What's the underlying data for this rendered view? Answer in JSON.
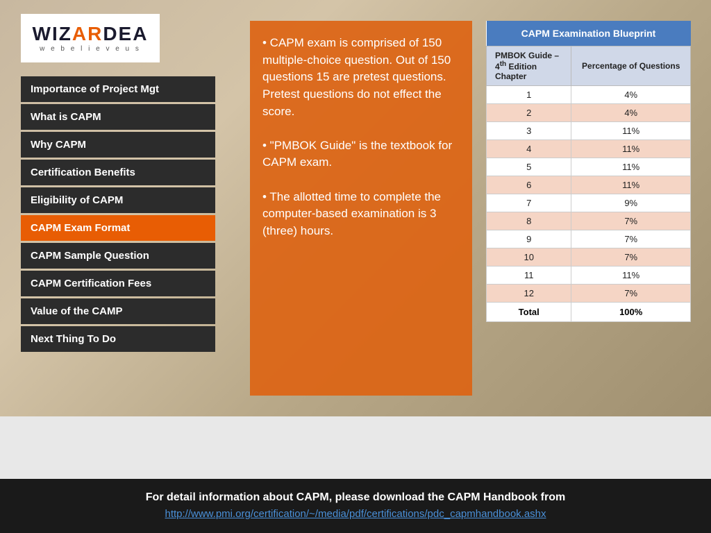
{
  "logo": {
    "text_wi": "WIZ",
    "text_ar": "AR",
    "text_dea": "DEA",
    "tagline": "w e   b e l i e v e   u s"
  },
  "sidebar": {
    "items": [
      {
        "label": "Importance of Project Mgt",
        "active": false
      },
      {
        "label": "What is CAPM",
        "active": false
      },
      {
        "label": "Why CAPM",
        "active": false
      },
      {
        "label": "Certification Benefits",
        "active": false
      },
      {
        "label": "Eligibility of CAPM",
        "active": false
      },
      {
        "label": "CAPM Exam Format",
        "active": true
      },
      {
        "label": "CAPM Sample Question",
        "active": false
      },
      {
        "label": "CAPM Certification Fees",
        "active": false
      },
      {
        "label": "Value of the CAMP",
        "active": false
      },
      {
        "label": "Next Thing To Do",
        "active": false
      }
    ]
  },
  "content": {
    "text": "• CAPM exam is comprised of 150 multiple-choice question. Out of 150 questions 15 are pretest questions. Pretest questions do not effect the score.\n• \"PMBOK Guide\" is the textbook for CAPM exam.\n• The allotted time to complete the computer-based examination is 3 (three) hours."
  },
  "table": {
    "title": "CAPM Examination Blueprint",
    "col1_header": "PMBOK Guide – 4th Edition Chapter",
    "col2_header": "Percentage of Questions",
    "rows": [
      {
        "chapter": "1",
        "percent": "4%"
      },
      {
        "chapter": "2",
        "percent": "4%"
      },
      {
        "chapter": "3",
        "percent": "11%"
      },
      {
        "chapter": "4",
        "percent": "11%"
      },
      {
        "chapter": "5",
        "percent": "11%"
      },
      {
        "chapter": "6",
        "percent": "11%"
      },
      {
        "chapter": "7",
        "percent": "9%"
      },
      {
        "chapter": "8",
        "percent": "7%"
      },
      {
        "chapter": "9",
        "percent": "7%"
      },
      {
        "chapter": "10",
        "percent": "7%"
      },
      {
        "chapter": "11",
        "percent": "11%"
      },
      {
        "chapter": "12",
        "percent": "7%"
      }
    ],
    "total_label": "Total",
    "total_value": "100%"
  },
  "footer": {
    "text": "For detail information about CAPM, please download the CAPM Handbook from",
    "link_text": "http://www.pmi.org/certification/~/media/pdf/certifications/pdc_capmhandbook.ashx",
    "link_href": "http://www.pmi.org/certification/~/media/pdf/certifications/pdc_capmhandbook.ashx"
  }
}
